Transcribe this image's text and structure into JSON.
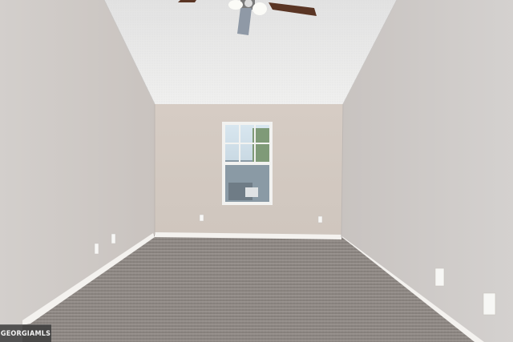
{
  "scene": {
    "description_visible_text": "",
    "colors": {
      "ceiling": "#e9e9e8",
      "back_wall": "#d2c8c0",
      "left_wall": "#cfcac6",
      "right_wall": "#cfcbc8",
      "carpet": "#8f8a86",
      "baseboard": "#f4f2ef",
      "window_frame": "#f2f2f0",
      "window_glass": "#9fb6c4",
      "fan_blade": "#5a3524"
    },
    "icons": [
      "ceiling-fan-icon",
      "window-icon",
      "outlet-icon"
    ]
  },
  "watermark": {
    "label": "GEORGIAMLS"
  }
}
